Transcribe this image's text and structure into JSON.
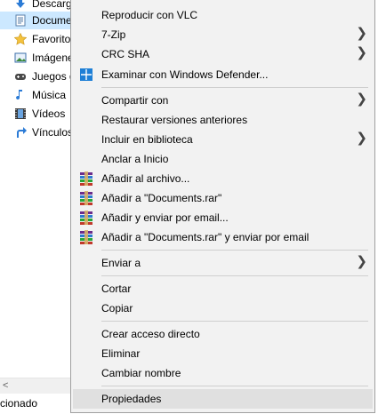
{
  "nav": {
    "items": [
      {
        "label": "Descarg",
        "icon": "download-arrow-icon"
      },
      {
        "label": "Docume",
        "icon": "documents-icon"
      },
      {
        "label": "Favorito",
        "icon": "star-icon"
      },
      {
        "label": "Imágene",
        "icon": "pictures-icon"
      },
      {
        "label": "Juegos g",
        "icon": "games-icon"
      },
      {
        "label": "Música",
        "icon": "music-note-icon"
      },
      {
        "label": "Vídeos",
        "icon": "film-icon"
      },
      {
        "label": "Vínculos",
        "icon": "link-arrow-icon"
      }
    ]
  },
  "status": {
    "text": "cionado"
  },
  "menu": {
    "items": [
      {
        "label": "Reproducir con VLC"
      },
      {
        "label": "7-Zip",
        "submenu": true
      },
      {
        "label": "CRC SHA",
        "submenu": true
      },
      {
        "label": "Examinar con Windows Defender...",
        "icon": "windows-defender-icon"
      },
      {
        "label": "Compartir con",
        "submenu": true
      },
      {
        "label": "Restaurar versiones anteriores"
      },
      {
        "label": "Incluir en biblioteca",
        "submenu": true
      },
      {
        "label": "Anclar a Inicio"
      },
      {
        "label": "Añadir al archivo...",
        "icon": "winrar-icon"
      },
      {
        "label": "Añadir a \"Documents.rar\"",
        "icon": "winrar-icon"
      },
      {
        "label": "Añadir y enviar por email...",
        "icon": "winrar-icon"
      },
      {
        "label": "Añadir a \"Documents.rar\" y enviar por email",
        "icon": "winrar-icon"
      },
      {
        "label": "Enviar a",
        "submenu": true
      },
      {
        "label": "Cortar"
      },
      {
        "label": "Copiar"
      },
      {
        "label": "Crear acceso directo"
      },
      {
        "label": "Eliminar"
      },
      {
        "label": "Cambiar nombre"
      },
      {
        "label": "Propiedades",
        "highlighted": true
      }
    ],
    "submenu_glyph": "❯"
  },
  "colors": {
    "menu_bg": "#f2f2f2",
    "hover_bg": "#e0e0e0",
    "selected_nav_bg": "#cce8ff",
    "defender_blue": "#1e7fd6"
  }
}
